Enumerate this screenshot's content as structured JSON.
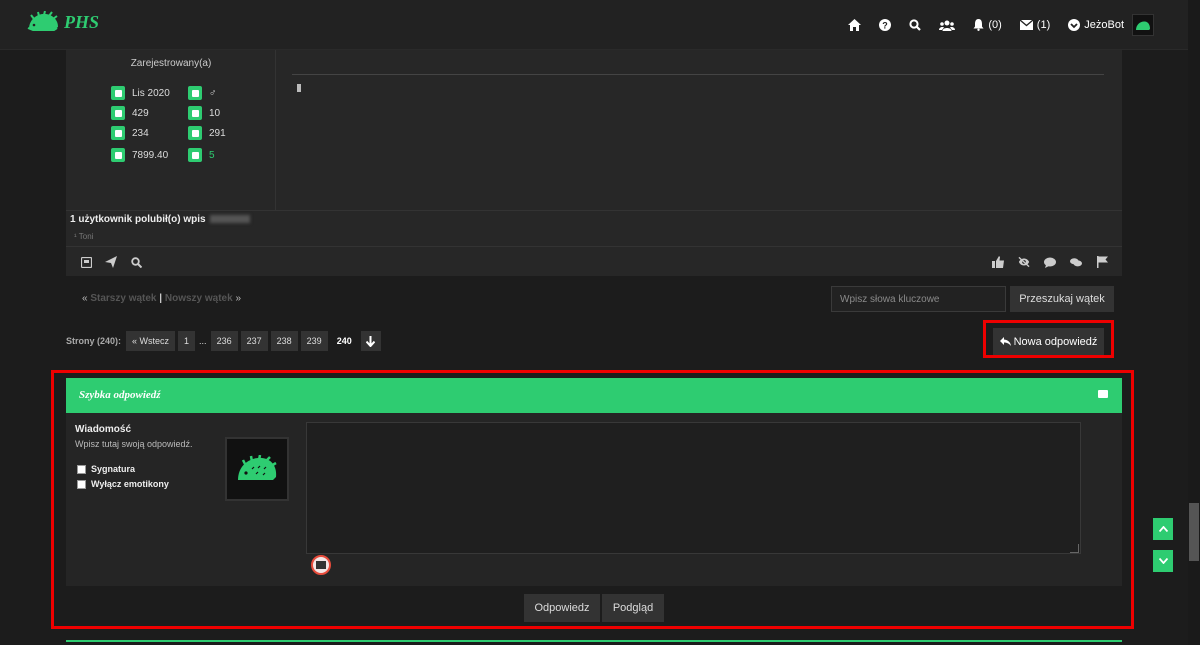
{
  "brand": {
    "name": "PHS",
    "accent": "#2ecc71"
  },
  "nav": {
    "notifications": "(0)",
    "messages": "(1)",
    "username": "JeżoBot"
  },
  "post": {
    "registered_label": "Zarejestrowany(a)",
    "stats": {
      "joined": "Lis 2020",
      "gender": "♂",
      "posts": "429",
      "topics": "10",
      "likes_given": "234",
      "likes_received": "291",
      "points": "7899.40",
      "level": "5"
    },
    "likes_text": "1 użytkownik polubił(o) wpis",
    "likes_sub": "¹ Toni"
  },
  "thread_nav": {
    "older": "Starszy wątek",
    "newer": "Nowszy wątek",
    "open_quote": "«",
    "close_quote": "»",
    "separator": "|",
    "search_placeholder": "Wpisz słowa kluczowe",
    "search_button": "Przeszukaj wątek"
  },
  "pagination": {
    "label": "Strony (240):",
    "prev": "« Wstecz",
    "pages": [
      "1",
      "...",
      "236",
      "237",
      "238",
      "239"
    ],
    "current": "240"
  },
  "new_reply_button": "Nowa odpowiedź",
  "quick_reply": {
    "title": "Szybka odpowiedź",
    "message_label": "Wiadomość",
    "message_hint": "Wpisz tutaj swoją odpowiedź.",
    "signature_label": "Sygnatura",
    "disable_smilies_label": "Wyłącz emotikony",
    "submit_button": "Odpowiedz",
    "preview_button": "Podgląd"
  }
}
